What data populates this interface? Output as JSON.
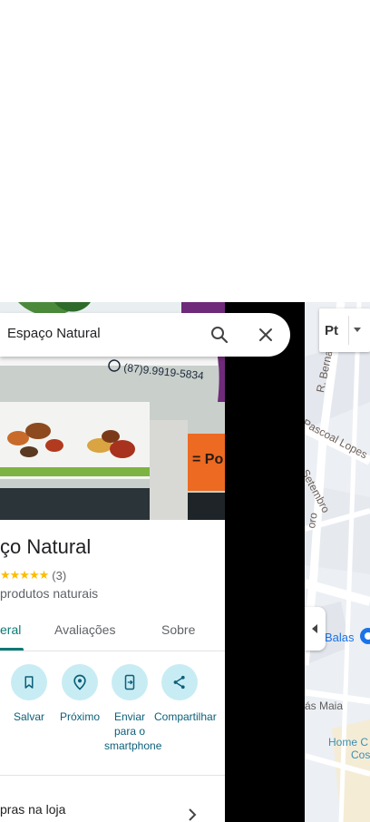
{
  "search": {
    "value": "Espaço Natural"
  },
  "hero": {
    "phone_text": "(87)9.9919-5834",
    "sign_fragment": "= Po"
  },
  "place": {
    "title": "ço Natural",
    "stars": "★★★★★",
    "rating_count": "(3)",
    "category": "produtos naturais"
  },
  "tabs": [
    {
      "label": "eral",
      "active": true
    },
    {
      "label": "Avaliações",
      "active": false
    },
    {
      "label": "Sobre",
      "active": false
    }
  ],
  "actions": [
    {
      "label": "Salvar",
      "icon": "bookmark-icon"
    },
    {
      "label": "Próximo",
      "icon": "nearby-icon"
    },
    {
      "label": "Enviar para o smartphone",
      "icon": "send-to-phone-icon"
    },
    {
      "label": "Compartilhar",
      "icon": "share-icon"
    }
  ],
  "info": {
    "label": "pras na loja"
  },
  "map": {
    "layer_label": "Pt",
    "labels": {
      "street_bernardo": "R. Bernardo",
      "street_pascoal": "Pascoal Lopes",
      "street_setembro": "Setembro",
      "street_oro": "oro",
      "balas": "Balas",
      "maia": "ás Maia",
      "home": "Home C",
      "cos": "Cos"
    }
  },
  "colors": {
    "accent": "#0b7a75",
    "action_circle": "#c8ecf3",
    "star": "#fbbc04"
  }
}
